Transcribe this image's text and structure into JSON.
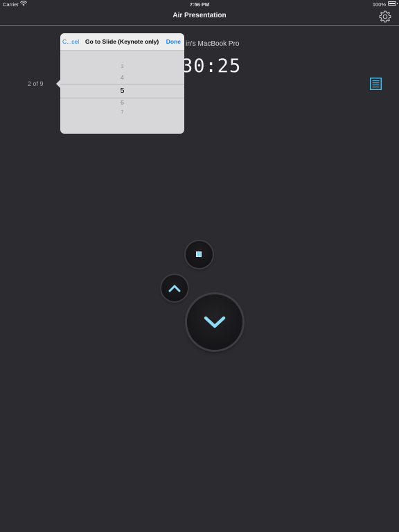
{
  "status_bar": {
    "carrier": "Carrier",
    "time": "7:56 PM",
    "battery": "100%"
  },
  "nav": {
    "title": "Air Presentation",
    "settings_icon": "gear-icon"
  },
  "presenter": {
    "device_name_visible": "in's MacBook Pro",
    "timer_visible": "30:25",
    "slide_position": "2 of 9",
    "notes_icon": "notes-icon"
  },
  "go_to_slide_popover": {
    "cancel_label": "C...cel",
    "title": "Go to Slide (Keynote only)",
    "done_label": "Done",
    "picker_rows": [
      "3",
      "4",
      "5",
      "6",
      "7"
    ],
    "selected_value": "5"
  },
  "controls": {
    "stop_icon": "stop-icon",
    "previous_icon": "chevron-up-icon",
    "next_icon": "chevron-down-icon"
  },
  "colors": {
    "background": "#2c2c30",
    "accent_blue": "#1a7cf5",
    "control_cyan": "#8fdaf5"
  }
}
